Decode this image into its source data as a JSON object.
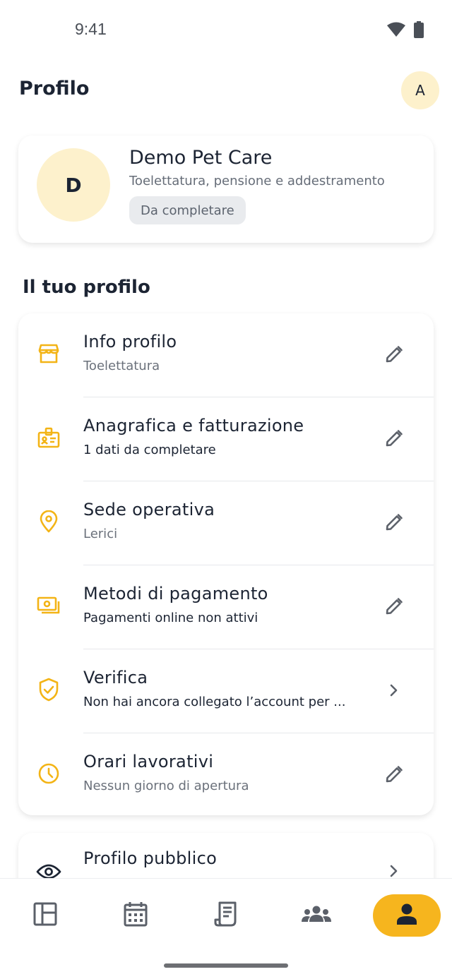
{
  "status_bar": {
    "time": "9:41"
  },
  "header": {
    "title": "Profilo",
    "avatar_initial": "A"
  },
  "business": {
    "initial": "D",
    "name": "Demo Pet Care",
    "description": "Toelettatura, pensione e addestramento",
    "badge": "Da completare"
  },
  "section": {
    "title": "Il tuo profilo"
  },
  "rows": [
    {
      "title": "Info profilo",
      "subtitle": "Toelettatura",
      "icon": "store-icon",
      "action": "edit"
    },
    {
      "title": "Anagrafica e fatturazione",
      "subtitle": "1 dati da completare",
      "icon": "id-badge-icon",
      "action": "edit"
    },
    {
      "title": "Sede operativa",
      "subtitle": "Lerici",
      "icon": "location-pin-icon",
      "action": "edit"
    },
    {
      "title": "Metodi di pagamento",
      "subtitle": "Pagamenti online non attivi",
      "icon": "payments-icon",
      "action": "edit"
    },
    {
      "title": "Verifica",
      "subtitle": "Non hai ancora collegato l’account per ...",
      "icon": "shield-check-icon",
      "action": "chevron"
    },
    {
      "title": "Orari lavorativi",
      "subtitle": "Nessun giorno di apertura",
      "icon": "clock-icon",
      "action": "edit"
    }
  ],
  "public_profile": {
    "title": "Profilo pubblico",
    "icon": "eye-icon",
    "action": "chevron"
  },
  "bottom_nav": [
    {
      "icon": "dashboard-icon",
      "active": false
    },
    {
      "icon": "calendar-icon",
      "active": false
    },
    {
      "icon": "receipt-icon",
      "active": false
    },
    {
      "icon": "group-icon",
      "active": false
    },
    {
      "icon": "person-icon",
      "active": true
    }
  ],
  "colors": {
    "accent": "#f6b51e",
    "icon_yellow": "#f3b416",
    "avatar_bg": "#fdf1cc",
    "text_primary": "#1c2433",
    "text_secondary": "#6b717b",
    "badge_bg": "#e9ebee"
  }
}
